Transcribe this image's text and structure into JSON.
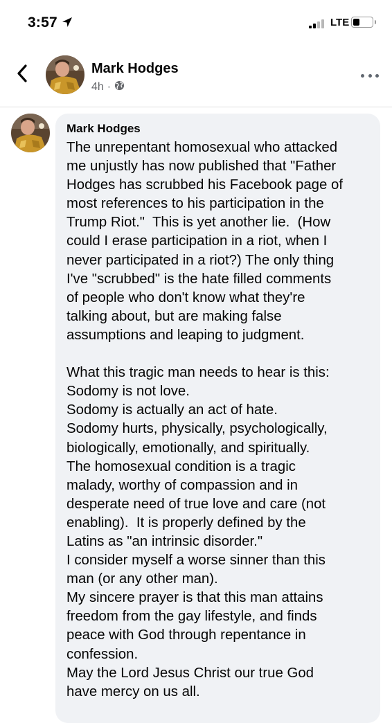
{
  "status_bar": {
    "time": "3:57",
    "network": "LTE",
    "signal_bars_total": 4,
    "signal_bars_active": 2,
    "battery_level": 0.35,
    "icons": [
      "location-arrow-icon",
      "signal-icon",
      "battery-icon"
    ]
  },
  "header": {
    "back_icon": "chevron-left-icon",
    "name": "Mark Hodges",
    "time_ago": "4h",
    "separator": "·",
    "privacy_icon": "globe-icon",
    "more_icon": "more-horizontal-icon"
  },
  "comment": {
    "author": "Mark Hodges",
    "lines": [
      "The unrepentant homosexual who attacked",
      "me unjustly has now published that \"Father",
      "Hodges has scrubbed his Facebook page of",
      "most references to his participation in the",
      "Trump Riot.\"  This is yet another lie.  (How",
      "could I erase participation in a riot, when I",
      "never participated in a riot?) The only thing",
      "I've \"scrubbed\" is the hate filled comments",
      "of people who don't know what they're",
      "talking about, but are making false",
      "assumptions and leaping to judgment.",
      "",
      "What this tragic man needs to hear is this:",
      "Sodomy is not love.",
      "Sodomy is actually an act of hate.",
      "Sodomy hurts, physically, psychologically,",
      "biologically, emotionally, and spiritually.",
      "The homosexual condition is a tragic",
      "malady, worthy of compassion and in",
      "desperate need of true love and care (not",
      "enabling).  It is properly defined by the",
      "Latins as \"an intrinsic disorder.\"",
      "I consider myself a worse sinner than this",
      "man (or any other man).",
      "My sincere prayer is that this man attains",
      "freedom from the gay lifestyle, and finds",
      "peace with God through repentance in",
      "confession.",
      "May the Lord Jesus Christ our true God",
      "have mercy on us all."
    ]
  }
}
